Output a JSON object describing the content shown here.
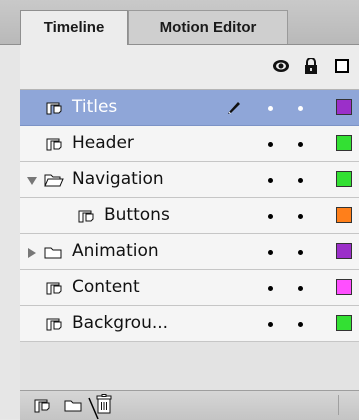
{
  "tabs": [
    {
      "label": "Timeline",
      "active": true
    },
    {
      "label": "Motion Editor",
      "active": false
    }
  ],
  "header_icons": [
    "eye-icon",
    "lock-icon",
    "outline-icon"
  ],
  "layers": [
    {
      "name": "Titles",
      "type": "layer",
      "selected": true,
      "editing": true,
      "color": "#9b2fc9"
    },
    {
      "name": "Header",
      "type": "layer",
      "selected": false,
      "color": "#33e033"
    },
    {
      "name": "Navigation",
      "type": "folder",
      "expanded": true,
      "selected": false,
      "color": "#33e033"
    },
    {
      "name": "Buttons",
      "type": "layer",
      "indent": true,
      "selected": false,
      "color": "#ff7f1a"
    },
    {
      "name": "Animation",
      "type": "folder",
      "expanded": false,
      "selected": false,
      "color": "#9b2fc9"
    },
    {
      "name": "Content",
      "type": "layer",
      "selected": false,
      "color": "#ff4fff"
    },
    {
      "name": "Backgrou...",
      "type": "layer",
      "selected": false,
      "color": "#33e033"
    }
  ],
  "toolbar_icons": [
    "new-layer-icon",
    "new-folder-icon",
    "delete-icon"
  ]
}
